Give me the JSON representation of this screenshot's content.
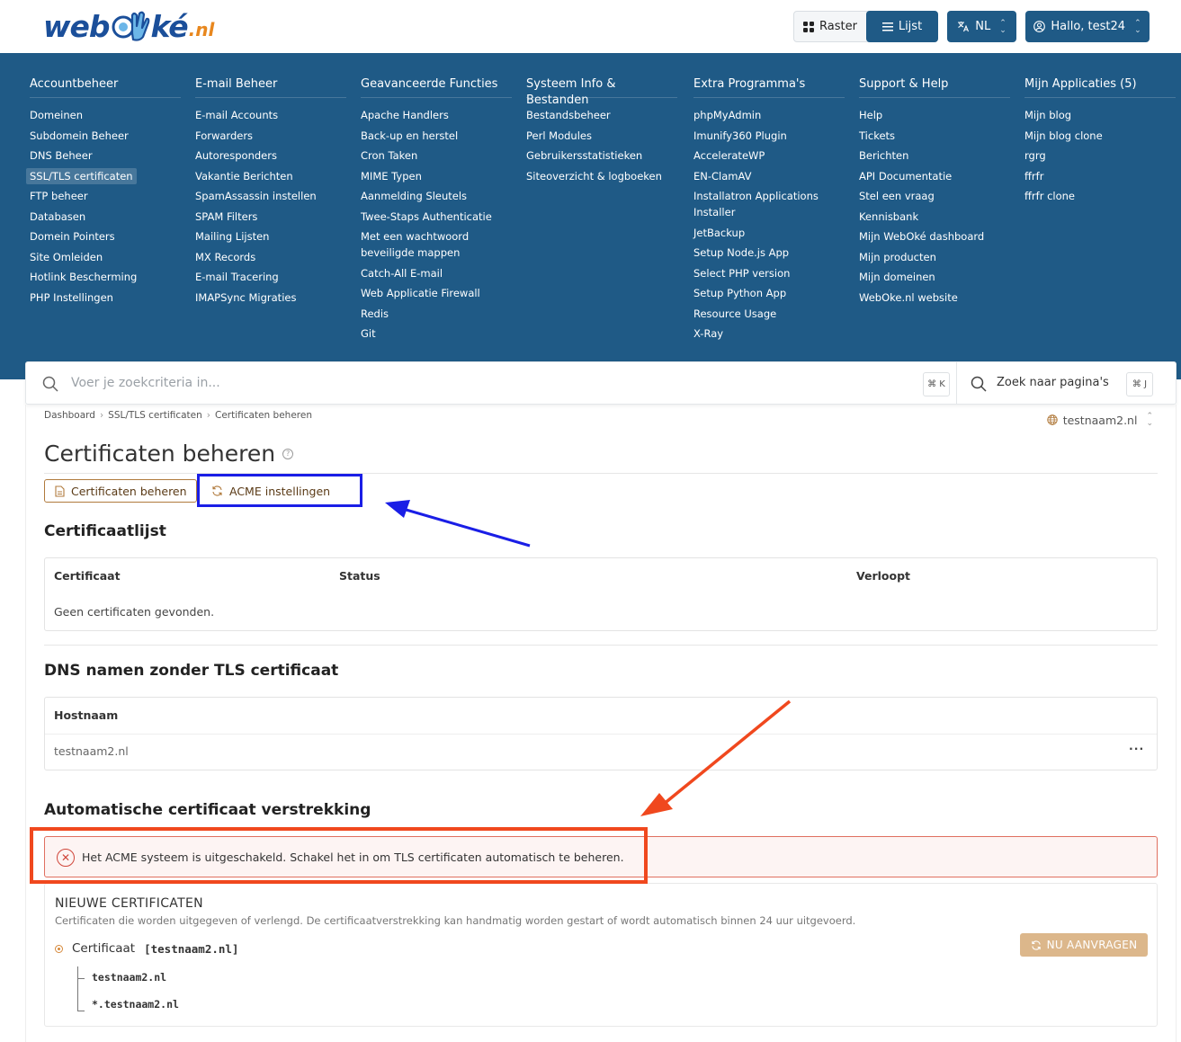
{
  "logo": {
    "part1": "web",
    "part2": "ké",
    "tld": ".nl"
  },
  "toolbar": {
    "raster": "Raster",
    "lijst": "Lijst",
    "language": "NL",
    "user": "Hallo, test24"
  },
  "nav": [
    {
      "title": "Accountbeheer",
      "items": [
        "Domeinen",
        "Subdomein Beheer",
        "DNS Beheer",
        "SSL/TLS certificaten",
        "FTP beheer",
        "Databasen",
        "Domein Pointers",
        "Site Omleiden",
        "Hotlink Bescherming",
        "PHP Instellingen"
      ]
    },
    {
      "title": "E-mail Beheer",
      "items": [
        "E-mail Accounts",
        "Forwarders",
        "Autoresponders",
        "Vakantie Berichten",
        "SpamAssassin instellen",
        "SPAM Filters",
        "Mailing Lijsten",
        "MX Records",
        "E-mail Tracering",
        "IMAPSync Migraties"
      ]
    },
    {
      "title": "Geavanceerde Functies",
      "items": [
        "Apache Handlers",
        "Back-up en herstel",
        "Cron Taken",
        "MIME Typen",
        "Aanmelding Sleutels",
        "Twee-Staps Authenticatie",
        "Met een wachtwoord beveiligde mappen",
        "Catch-All E-mail",
        "Web Applicatie Firewall",
        "Redis",
        "Git"
      ]
    },
    {
      "title": "Systeem Info & Bestanden",
      "items": [
        "Bestandsbeheer",
        "Perl Modules",
        "Gebruikersstatistieken",
        "Siteoverzicht & logboeken"
      ]
    },
    {
      "title": "Extra Programma's",
      "items": [
        "phpMyAdmin",
        "Imunify360 Plugin",
        "AccelerateWP",
        "EN-ClamAV",
        "Installatron Applications Installer",
        "JetBackup",
        "Setup Node.js App",
        "Select PHP version",
        "Setup Python App",
        "Resource Usage",
        "X-Ray"
      ]
    },
    {
      "title": "Support & Help",
      "items": [
        "Help",
        "Tickets",
        "Berichten",
        "API Documentatie",
        "Stel een vraag",
        "Kennisbank",
        "Mijn WebOké dashboard",
        "Mijn producten",
        "Mijn domeinen",
        "WebOke.nl website"
      ]
    },
    {
      "title": "Mijn Applicaties (5)",
      "items": [
        "Mijn blog",
        "Mijn blog clone",
        "rgrg",
        "ffrfr",
        "ffrfr clone"
      ]
    }
  ],
  "search": {
    "placeholder": "Voer je zoekcriteria in...",
    "shortcut": "⌘ K",
    "pages_label": "Zoek naar pagina's",
    "pages_shortcut": "⌘ J"
  },
  "breadcrumb": [
    "Dashboard",
    "SSL/TLS certificaten",
    "Certificaten beheren"
  ],
  "domain_selector": "testnaam2.nl",
  "page_title": "Certificaten beheren",
  "tabs": [
    "Certificaten beheren",
    "ACME instellingen"
  ],
  "certificate_list": {
    "heading": "Certificaatlijst",
    "columns": [
      "Certificaat",
      "Status",
      "Verloopt"
    ],
    "empty": "Geen certificaten gevonden."
  },
  "dns_without_tls": {
    "heading": "DNS namen zonder TLS certificaat",
    "column": "Hostnaam",
    "rows": [
      "testnaam2.nl"
    ],
    "menu": "···"
  },
  "auto_provisioning": {
    "heading": "Automatische certificaat verstrekking",
    "alert": "Het ACME systeem is uitgeschakeld. Schakel het in om TLS certificaten automatisch te beheren.",
    "panel_title": "NIEUWE CERTIFICATEN",
    "panel_desc": "Certificaten die worden uitgegeven of verlengd. De certificaatverstrekking kan handmatig worden gestart of wordt automatisch binnen 24 uur uitgevoerd.",
    "cert_label": "Certificaat",
    "cert_name": "[testnaam2.nl]",
    "hosts": [
      "testnaam2.nl",
      "*.testnaam2.nl"
    ],
    "request_button": "NU AANVRAGEN"
  },
  "colors": {
    "nav_bg": "#1f5a86",
    "accent_brown": "#b07a3c",
    "alert_red": "#d0463a",
    "annotation_blue": "#1a1ee6",
    "annotation_orange": "#f0481e"
  }
}
